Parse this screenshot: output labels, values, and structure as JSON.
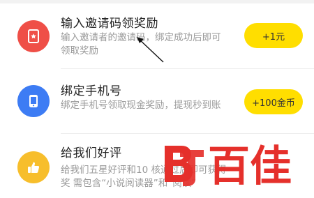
{
  "tasks": [
    {
      "title": "输入邀请码领奖励",
      "description": "输入邀请者的邀请码，绑定成功后即可领取奖励",
      "reward": "+1元",
      "icon": "red-envelope-icon",
      "color": "#ef4f47"
    },
    {
      "title": "绑定手机号",
      "description": "绑定手机号领取现金奖励，提现秒到账",
      "reward": "+100金币",
      "icon": "phone-icon",
      "color": "#3d7cf4"
    },
    {
      "title": "给我们好评",
      "description": "给我们五星好评和10 核通过后即可获得奖 需包含“小说阅读器”和“阅读”",
      "icon": "thumbs-up-icon",
      "color": "#f7be2c"
    }
  ],
  "button_color": "#ffde00",
  "watermark": {
    "text": "百佳",
    "color": "#e5302b"
  }
}
